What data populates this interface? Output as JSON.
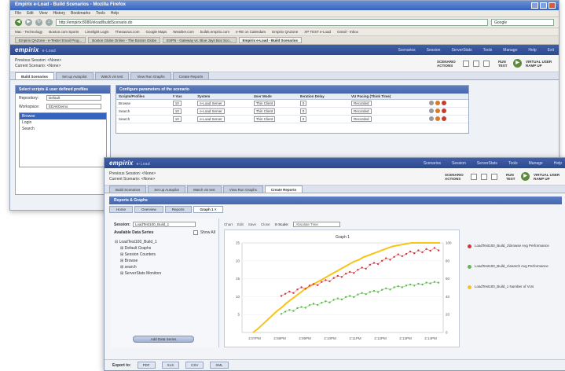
{
  "back": {
    "browser_title": "Empirix e-Load - Build Scenarios - Mozilla Firefox",
    "menu": [
      "File",
      "Edit",
      "View",
      "History",
      "Bookmarks",
      "Tools",
      "Help"
    ],
    "url": "http://empirix:8080/eload/buildScenario.do",
    "search_placeholder": "Google",
    "bookmarks": [
      "Mac - Technology",
      "Boston.com Sports",
      "Limelight Login",
      "Thesaurus.com",
      "Google Maps",
      "Weather.com",
      "builds.empirix.com",
      "e-RE on Calendars",
      "Empirix QAZone",
      "XP TEST e-Load",
      "Gmail - Inbox"
    ],
    "browser_tabs": [
      "Empirix QAZone - e-Tester Email Prog...",
      "Boston Globe Online - The Boston Globe",
      "ESPN - Gateway vs. Blue Jays Box Sco...",
      "Empirix e-Load - Build Scenarios"
    ],
    "app_logo": "empirix",
    "app_product": "e-Load",
    "app_menu": [
      "Scenarios",
      "Session",
      "ServerStats",
      "Tools",
      "Manage",
      "Help",
      "Exit"
    ],
    "previous_session": "Previous Session: <None>",
    "current_scenario": "Current Scenario: <None>",
    "scenario_actions": "SCENARIO ACTIONS",
    "run_test": "RUN TEST",
    "virtual_user_label": "VIRTUAL USER RAMP UP",
    "tabs": [
      "Build Scenarios",
      "Set up Autopilot",
      "Watch vis test",
      "View Run Graphs",
      "Create Reports"
    ],
    "left_panel_title": "Select scripts & user defined profiles",
    "repository_label": "Repository:",
    "repository_value": "Default",
    "workspace_label": "Workspace:",
    "workspace_value": "EDAKDemo",
    "scripts": [
      "Browse",
      "Login",
      "Search"
    ],
    "right_panel_title": "Configure parameters of the scenario",
    "columns": [
      "Scripts/Profiles",
      "# Vus",
      "System",
      "User Mode",
      "Iteration Delay",
      "VU Pacing (Think Time)"
    ],
    "rows": [
      {
        "script": "Browse",
        "vus": "10",
        "system": "e-Load Server",
        "mode": "Thin Client",
        "delay": "0",
        "pacing": "Recorded"
      },
      {
        "script": "Search",
        "vus": "10",
        "system": "e-Load Server",
        "mode": "Thin Client",
        "delay": "0",
        "pacing": "Recorded"
      },
      {
        "script": "Search",
        "vus": "10",
        "system": "e-Load Server",
        "mode": "Thin Client",
        "delay": "0",
        "pacing": "Recorded"
      }
    ]
  },
  "front": {
    "app_logo": "empirix",
    "app_product": "e-Load",
    "app_menu": [
      "Scenarios",
      "Session",
      "ServerStats",
      "Tools",
      "Manage",
      "Help"
    ],
    "previous_session": "Previous Session: <None>",
    "current_scenario": "Current Scenario: <None>",
    "scenario_actions": "SCENARIO ACTIONS",
    "run_test": "RUN TEST",
    "virtual_user_label": "VIRTUAL USER RAMP UP",
    "tabs": [
      "Build Scenarios",
      "Set up Autopilot",
      "Watch vis test",
      "View Run Graphs",
      "Create Reports"
    ],
    "section_title": "Reports & Graphs",
    "subtabs": [
      "Home",
      "Overview",
      "Reports",
      "Graph 1"
    ],
    "session_label": "Session:",
    "session_value": "LoadTest100_Build_1",
    "available_series": "Available Data Series",
    "show_all": "Show All",
    "tree": [
      "LoadTest100_Build_1",
      "Default Graphs",
      "Session Counters",
      "Browse",
      "search",
      "ServerStats Monitors"
    ],
    "add_button": "Add Data Series",
    "toolbar": [
      "Chart",
      "Edit",
      "Save",
      "Close",
      "X-Scale:",
      "Absolute Time"
    ],
    "export_label": "Export to:",
    "export_buttons": [
      "PDF",
      "XLS",
      "CSV",
      "XML"
    ]
  },
  "chart_data": {
    "type": "line",
    "title": "Graph 1",
    "x": [
      "2:07PM",
      "2:08PM",
      "2:09PM",
      "2:10PM",
      "2:11PM",
      "2:12PM",
      "2:13PM",
      "2:14PM"
    ],
    "ylim_left": [
      0,
      25
    ],
    "ylim_right": [
      0,
      100
    ],
    "yticks_left": [
      5,
      10,
      15,
      20,
      25
    ],
    "yticks_right": [
      0,
      20,
      40,
      60,
      80,
      100
    ],
    "series": [
      {
        "name": "LoadTest100_Build_1\\browse Avg Performance",
        "color": "#d9333a",
        "axis": "left",
        "values": [
          10.2,
          10.8,
          11.4,
          11.0,
          12.0,
          12.6,
          12.2,
          13.1,
          13.5,
          13.2,
          14.1,
          14.6,
          14.3,
          15.2,
          15.8,
          15.5,
          16.4,
          16.9,
          16.6,
          17.5,
          18.1,
          17.8,
          18.9,
          19.4,
          19.1,
          20.0,
          20.7,
          20.3,
          21.1,
          21.8,
          21.3,
          21.9,
          22.6,
          22.1,
          22.9,
          22.4,
          23.3,
          22.8,
          23.6,
          22.9
        ]
      },
      {
        "name": "LoadTest100_Build_1\\search Avg Performance",
        "color": "#5dbb4a",
        "axis": "left",
        "values": [
          5.2,
          5.8,
          6.3,
          6.0,
          6.8,
          7.1,
          6.9,
          7.6,
          8.0,
          7.7,
          8.3,
          8.7,
          8.4,
          9.1,
          9.5,
          9.2,
          9.9,
          10.2,
          9.9,
          10.6,
          11.0,
          10.7,
          11.3,
          11.6,
          11.3,
          11.9,
          12.3,
          12.0,
          12.6,
          12.9,
          12.6,
          13.1,
          13.4,
          13.1,
          13.6,
          13.4,
          13.9,
          13.7,
          14.1,
          13.9
        ]
      },
      {
        "name": "LoadTest100_Build_1 Number of VUs",
        "color": "#f5c518",
        "axis": "right",
        "values": [
          0,
          4,
          9,
          14,
          19,
          24,
          28,
          33,
          37,
          41,
          45,
          49,
          52,
          55,
          58,
          61,
          64,
          67,
          70,
          73,
          76,
          79,
          81,
          84,
          86,
          88,
          90,
          92,
          94,
          96,
          97,
          98,
          99,
          100,
          100,
          100,
          100,
          100,
          100,
          100
        ]
      }
    ]
  }
}
